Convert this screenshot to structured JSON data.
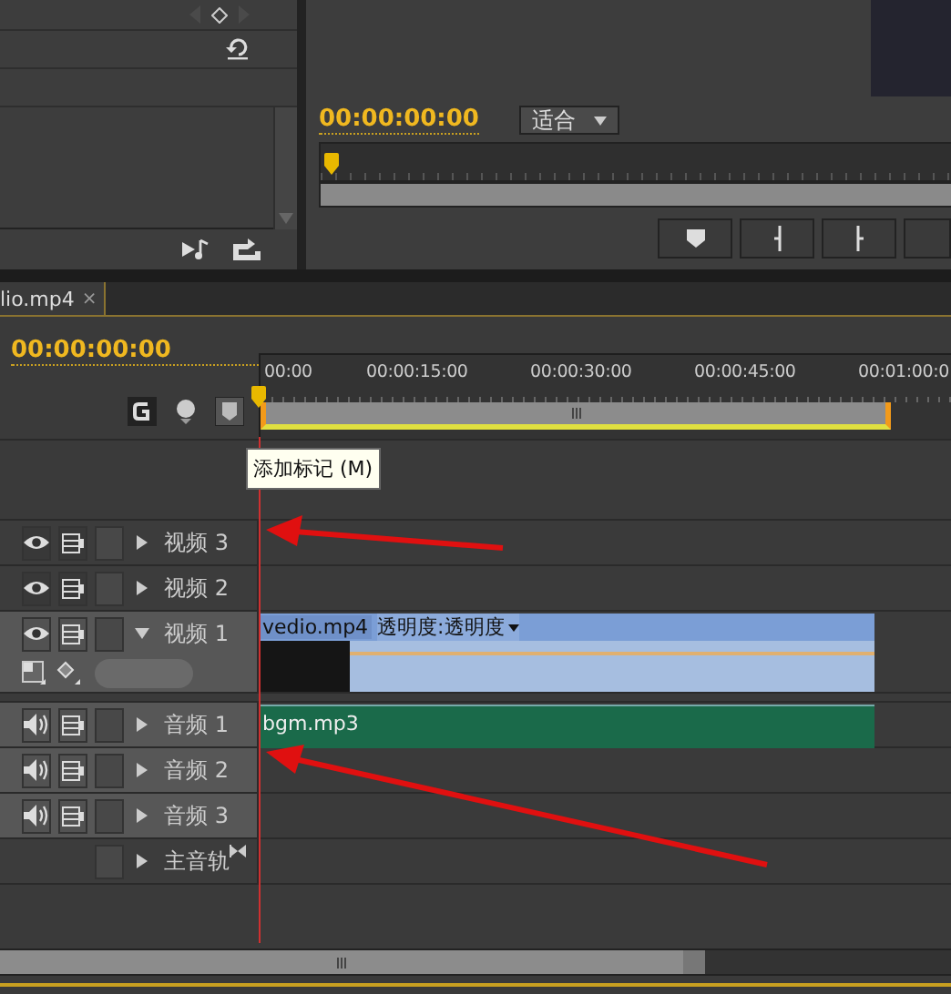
{
  "program_monitor": {
    "timecode": "00:00:00:00",
    "zoom_menu": "适合"
  },
  "timeline": {
    "tab": {
      "label": "lio.mp4",
      "close": "×",
      "selected": true
    },
    "timecode": "00:00:00:00",
    "ruler_labels": [
      "00:00",
      "00:00:15:00",
      "00:00:30:00",
      "00:00:45:00",
      "00:01:00:0"
    ],
    "tooltip": "添加标记 (M)",
    "tracks": [
      {
        "kind": "video",
        "name": "视频 3",
        "expanded": false,
        "targeted": false
      },
      {
        "kind": "video",
        "name": "视频 2",
        "expanded": false,
        "targeted": false
      },
      {
        "kind": "video",
        "name": "视频 1",
        "expanded": true,
        "targeted": true,
        "clips": [
          {
            "name": "vedio.mp4",
            "effect": "透明度:透明度"
          }
        ]
      },
      {
        "kind": "audio",
        "name": "音频 1",
        "expanded": false,
        "targeted": true,
        "clips": [
          {
            "name": "bgm.mp3"
          }
        ]
      },
      {
        "kind": "audio",
        "name": "音频 2",
        "expanded": false,
        "targeted": true
      },
      {
        "kind": "audio",
        "name": "音频 3",
        "expanded": false,
        "targeted": true
      },
      {
        "kind": "master",
        "name": "主音轨",
        "expanded": false,
        "targeted": false
      }
    ]
  }
}
